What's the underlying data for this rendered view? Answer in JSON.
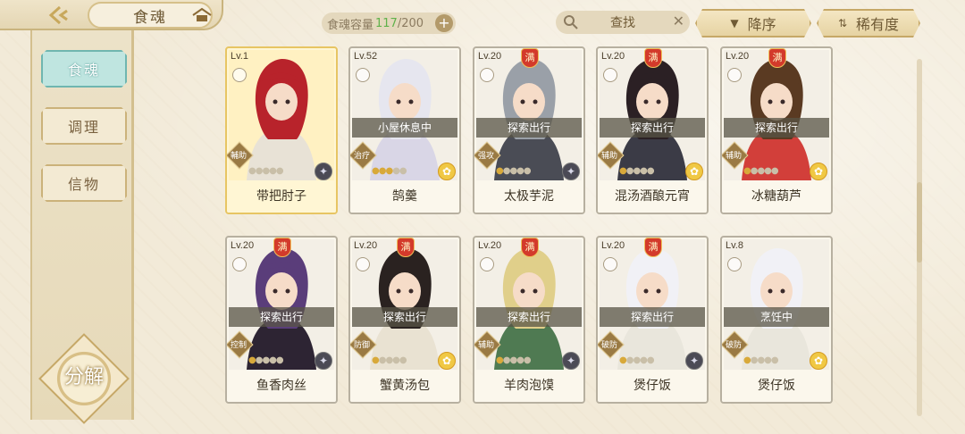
{
  "header": {
    "title": "食魂",
    "capacity_label": "食魂容量",
    "capacity_current": "117",
    "capacity_total": "/200",
    "search_label": "查找",
    "sort_label": "降序",
    "rarity_label": "稀有度"
  },
  "sidebar": {
    "items": [
      {
        "label": "食魂"
      },
      {
        "label": "调理"
      },
      {
        "label": "信物"
      }
    ],
    "decompose_label": "分解"
  },
  "cards": [
    {
      "level": "Lv.1",
      "name": "带把肘子",
      "role": "輔助",
      "status": "",
      "full": false,
      "stars": 0,
      "element": "dark",
      "gold": true,
      "hair": "#b8232b",
      "cloth": "#e8e2d6"
    },
    {
      "level": "Lv.52",
      "name": "鹄羹",
      "role": "治疗",
      "status": "小屋休息中",
      "full": false,
      "stars": 3,
      "element": "gold",
      "gold": false,
      "hair": "#e6e6ef",
      "cloth": "#d9d6e6"
    },
    {
      "level": "Lv.20",
      "name": "太极芋泥",
      "role": "强攻",
      "status": "探索出行",
      "full": true,
      "stars": 1,
      "element": "dark",
      "gold": false,
      "hair": "#9aa0a8",
      "cloth": "#4a4c55"
    },
    {
      "level": "Lv.20",
      "name": "混汤酒酿元宵",
      "role": "辅助",
      "status": "探索出行",
      "full": true,
      "stars": 1,
      "element": "gold",
      "gold": false,
      "hair": "#2b2024",
      "cloth": "#3b3b46"
    },
    {
      "level": "Lv.20",
      "name": "冰糖葫芦",
      "role": "辅助",
      "status": "探索出行",
      "full": true,
      "stars": 1,
      "element": "gold",
      "gold": false,
      "hair": "#5a3a22",
      "cloth": "#d23f3a"
    },
    {
      "level": "Lv.20",
      "name": "鱼香肉丝",
      "role": "控制",
      "status": "探索出行",
      "full": true,
      "stars": 1,
      "element": "dark",
      "gold": false,
      "hair": "#5a3d7a",
      "cloth": "#2d2433"
    },
    {
      "level": "Lv.20",
      "name": "蟹黄汤包",
      "role": "防御",
      "status": "探索出行",
      "full": true,
      "stars": 1,
      "element": "gold",
      "gold": false,
      "hair": "#2a2220",
      "cloth": "#e9e2d2"
    },
    {
      "level": "Lv.20",
      "name": "羊肉泡馍",
      "role": "辅助",
      "status": "探索出行",
      "full": true,
      "stars": 1,
      "element": "dark",
      "gold": false,
      "hair": "#e0cf8a",
      "cloth": "#4f7a52"
    },
    {
      "level": "Lv.20",
      "name": "煲仔饭",
      "role": "破防",
      "status": "探索出行",
      "full": true,
      "stars": 1,
      "element": "dark",
      "gold": false,
      "hair": "#f1f1f6",
      "cloth": "#e9e6dc"
    },
    {
      "level": "Lv.8",
      "name": "煲仔饭",
      "role": "破防",
      "status": "烹饪中",
      "full": false,
      "stars": 1,
      "element": "gold",
      "gold": false,
      "hair": "#f1f1f6",
      "cloth": "#e9e6dc"
    }
  ],
  "full_badge_text": "满",
  "colors": {
    "accent": "#c6a867",
    "active_tab": "#bfe5e0",
    "capacity_current": "#5fb14a"
  }
}
